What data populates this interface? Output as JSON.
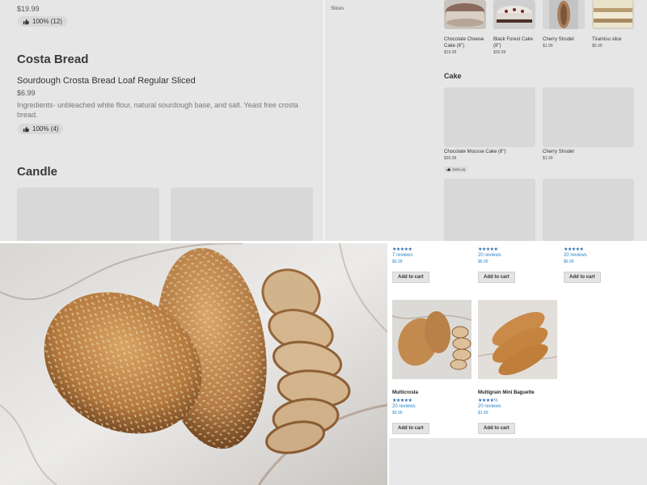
{
  "delivery_menu": {
    "top_price": "$19.99",
    "top_rating": "100% (12)",
    "section_bread": "Costa Bread",
    "item": {
      "name": "Sourdough Crosta Bread Loaf Regular Sliced",
      "price": "$6.99",
      "description": "Ingredients- unbleached white flour, natural sourdough base, and salt. Yeast free crosta bread.",
      "rating": "100% (4)"
    },
    "section_candle": "Candle"
  },
  "store_menu": {
    "sidebar_label": "Slices",
    "slices": [
      {
        "name": "Chocolate Cheese Cake (6\")",
        "price": "$19.99"
      },
      {
        "name": "Black Forest Cake (8\")",
        "price": "$39.99"
      },
      {
        "name": "Cherry Strudel",
        "price": "$1.99"
      },
      {
        "name": "Tiramisu slice",
        "price": "$6.99"
      }
    ],
    "section_cake": "Cake",
    "cakes": [
      {
        "name": "Chocolate Mousse Cake (8\")",
        "price": "$39.99",
        "rating": "100% (4)"
      },
      {
        "name": "Cherry Strudel",
        "price": "$1.99"
      }
    ]
  },
  "shop": {
    "top_row": [
      {
        "stars": "★★★★★",
        "reviews": "7 reviews",
        "price": "$6.99",
        "cart": "Add to cart"
      },
      {
        "stars": "★★★★★",
        "reviews": "20 reviews",
        "price": "$6.99",
        "cart": "Add to cart"
      },
      {
        "stars": "★★★★★",
        "reviews": "20 reviews",
        "price": "$6.99",
        "cart": "Add to cart"
      }
    ],
    "products": [
      {
        "name": "Multicrosta",
        "stars": "★★★★★",
        "reviews": "20 reviews",
        "price": "$6.99",
        "cart": "Add to cart"
      },
      {
        "name": "Multigrain Mini Baguette",
        "stars": "★★★★½",
        "reviews": "20 reviews",
        "price": "$1.99",
        "cart": "Add to cart"
      }
    ]
  },
  "colors": {
    "panel_gray": "#e6e6e6",
    "link_blue": "#2b86c9",
    "star_blue": "#2b6cb0"
  }
}
